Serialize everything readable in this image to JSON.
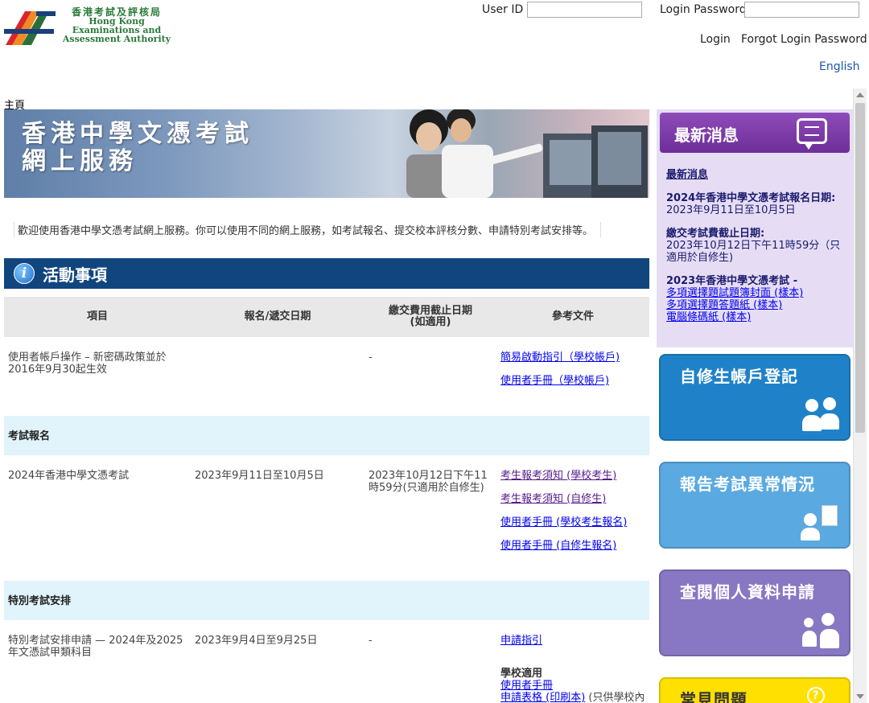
{
  "header": {
    "logo": {
      "zh": "香港考試及評核局",
      "en_line1": "Hong Kong",
      "en_line2": "Examinations and",
      "en_line3": "Assessment Authority"
    },
    "user_id_label": "User ID",
    "password_label": "Login Password",
    "user_id_value": "",
    "password_value": "",
    "login_link": "Login",
    "forgot_link": "Forgot Login Password",
    "language_link": "English"
  },
  "breadcrumb": "主頁",
  "banner": {
    "title_line1": "香港中學文憑考試",
    "title_line2": "網上服務"
  },
  "welcome": "歡迎使用香港中學文憑考試網上服務。你可以使用不同的網上服務，如考試報名、提交校本評核分數、申請特別考試安排等。",
  "events": {
    "title": "活動事項",
    "headers": {
      "item": "項目",
      "dates": "報名/遞交日期",
      "fee_line1": "繳交費用截止日期",
      "fee_line2": "(如適用)",
      "docs": "參考文件"
    },
    "account": {
      "item": "使用者帳戶操作 – 新密碼政策並於2016年9月30起生效",
      "dates": "",
      "fee": "-",
      "docs": [
        "簡易啟動指引（學校帳戶)",
        "使用者手冊（學校帳戶)"
      ]
    },
    "cat_registration": "考試報名",
    "registration": {
      "item": "2024年香港中學文憑考試",
      "dates": "2023年9月11日至10月5日",
      "fee": "2023年10月12日下午11時59分(只適用於自修生)",
      "docs": [
        "考生報考須知 (學校考生)",
        "考生報考須知 (自修生)",
        "使用者手冊 (學校考生報名)",
        "使用者手冊 (自修生報名)"
      ]
    },
    "cat_special": "特別考試安排",
    "special": {
      "item": "特別考試安排申請 — 2024年及2025年文憑試甲類科目",
      "dates": "2023年9月4日至9月25日",
      "fee": "-",
      "doc_guide": "申請指引",
      "school_label": "學校適用",
      "doc_manual": "使用者手冊",
      "doc_form": "申請表格 (印刷本)",
      "doc_form_note": "(只供學校內部使用)"
    }
  },
  "news": {
    "head": "最新消息",
    "title": "最新消息",
    "item1_head": "2024年香港中學文憑考試報名日期:",
    "item1_body": "2023年9月11日至10月5日",
    "item2_head": "繳交考試費截止日期:",
    "item2_body": "2023年10月12日下午11時59分（只適用於自修生)",
    "item3_head": "2023年香港中學文憑考試 -",
    "item3_links": [
      "多項選擇題試題簿封面 (樣本)",
      "多項選擇題答題紙 (樣本)",
      "電腦條碼紙 (樣本)"
    ]
  },
  "tiles": {
    "private_account": "自修生帳戶登記",
    "report_irregularity": "報告考試異常情況",
    "data_access": "查閱個人資料申請",
    "faq": "常見問題"
  }
}
